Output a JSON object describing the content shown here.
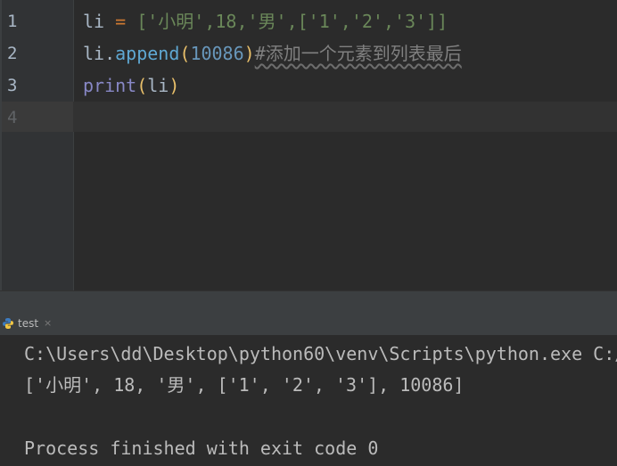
{
  "editor": {
    "lines": [
      {
        "number": "1",
        "code": {
          "ident": "li",
          "assign": " = ",
          "list_text": "['小明',18,'男',['1','2','3']]"
        }
      },
      {
        "number": "2",
        "code": {
          "obj": "li",
          "dot": ".",
          "method": "append",
          "open": "(",
          "arg": "10086",
          "close": ")",
          "comment": "#添加一个元素到列表最后"
        }
      },
      {
        "number": "3",
        "code": {
          "func": "print",
          "open": "(",
          "arg": "li",
          "close": ")"
        }
      },
      {
        "number": "4"
      }
    ]
  },
  "run_panel": {
    "tab_label": "test",
    "tab_close": "×"
  },
  "console": {
    "lines": [
      "C:\\Users\\dd\\Desktop\\python60\\venv\\Scripts\\python.exe C:/",
      "['小明', 18, '男', ['1', '2', '3'], 10086]",
      "",
      "Process finished with exit code 0"
    ]
  },
  "colors": {
    "editor_bg": "#2b2b2b",
    "gutter_bg": "#313335",
    "keyword_orange": "#cc7832",
    "string_green": "#6a8759",
    "number_blue": "#6897bb",
    "builtin_purple": "#8888c6",
    "comment_gray": "#808080",
    "console_text": "#bbbbbb"
  }
}
